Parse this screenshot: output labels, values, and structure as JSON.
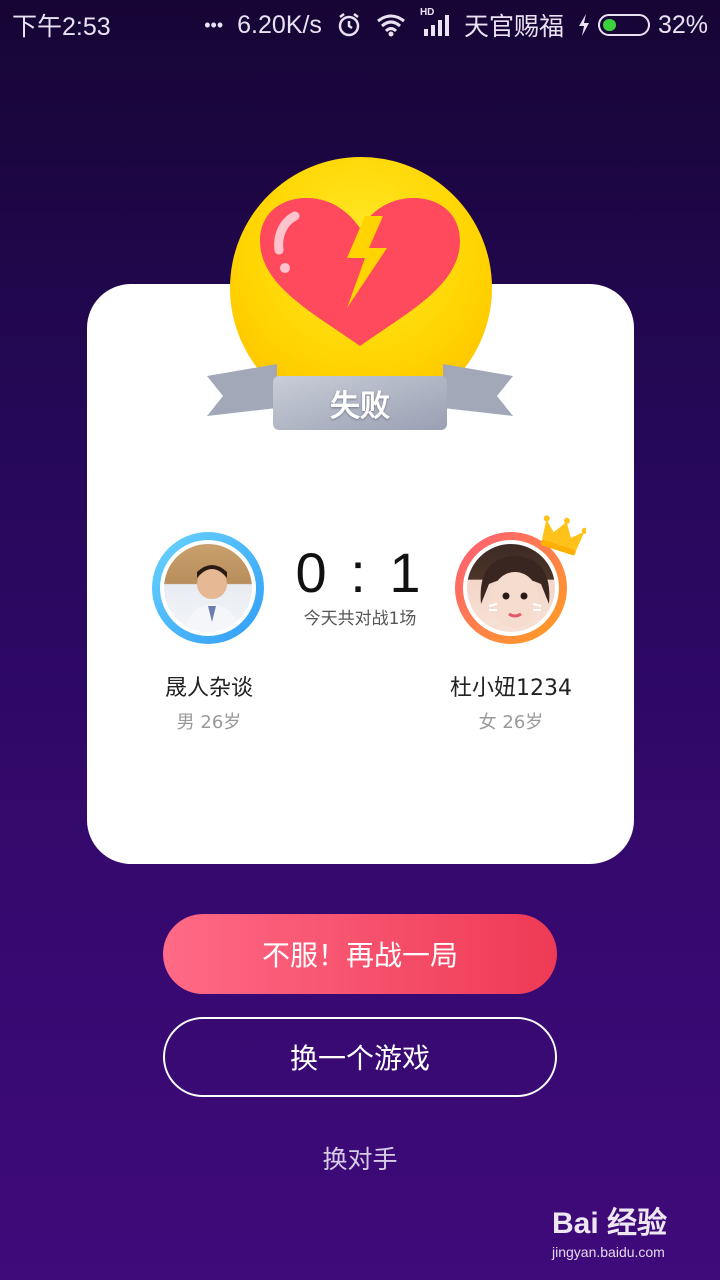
{
  "status_bar": {
    "time": "下午2:53",
    "dots": "•••",
    "speed": "6.20K/s",
    "network_badge": "HD",
    "carrier": "天官赐福",
    "battery": "32%",
    "battery_level": 0.32
  },
  "result": {
    "label": "失败",
    "score": "0 : 1",
    "battle_count": "今天共对战1场"
  },
  "players": {
    "left": {
      "name": "晟人杂谈",
      "meta": "男 26岁"
    },
    "right": {
      "name": "杜小妞1234",
      "meta": "女 26岁",
      "winner": true
    }
  },
  "actions": {
    "rematch": "不服！再战一局",
    "change_game": "换一个游戏",
    "change_opponent": "换对手"
  },
  "watermark": {
    "logo": "Bai 经验",
    "url": "jingyan.baidu.com"
  },
  "colors": {
    "rematch_gradient_start": "#ff6a86",
    "rematch_gradient_end": "#ee3a55",
    "medal": "#ffd400",
    "heart": "#ff4a5e"
  }
}
